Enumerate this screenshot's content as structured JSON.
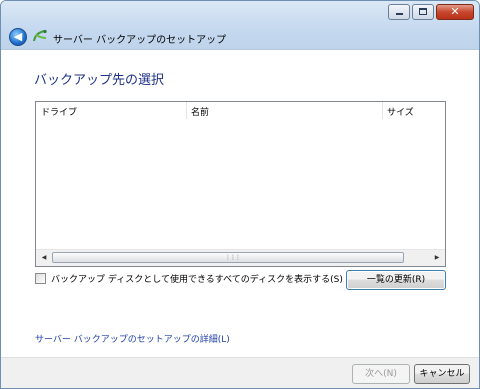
{
  "window": {
    "title": "サーバー バックアップのセットアップ",
    "controls": {
      "minimize": "minimize-icon",
      "maximize": "maximize-icon",
      "close": "close-icon"
    }
  },
  "heading": "バックアップ先の選択",
  "disk_list": {
    "columns": [
      "ドライブ",
      "名前",
      "サイズ"
    ],
    "rows": []
  },
  "show_all_disks_checkbox": {
    "label": "バックアップ ディスクとして使用できるすべてのディスクを表示する(S)",
    "checked": false
  },
  "refresh_button": "一覧の更新(R)",
  "details_link": "サーバー バックアップのセットアップの詳細(L)",
  "footer": {
    "next_button": "次へ(N)",
    "next_enabled": false,
    "cancel_button": "キャンセル"
  },
  "colors": {
    "heading": "#1e3287",
    "link": "#1e3fa6",
    "titlebar": "#c4d8ef"
  }
}
